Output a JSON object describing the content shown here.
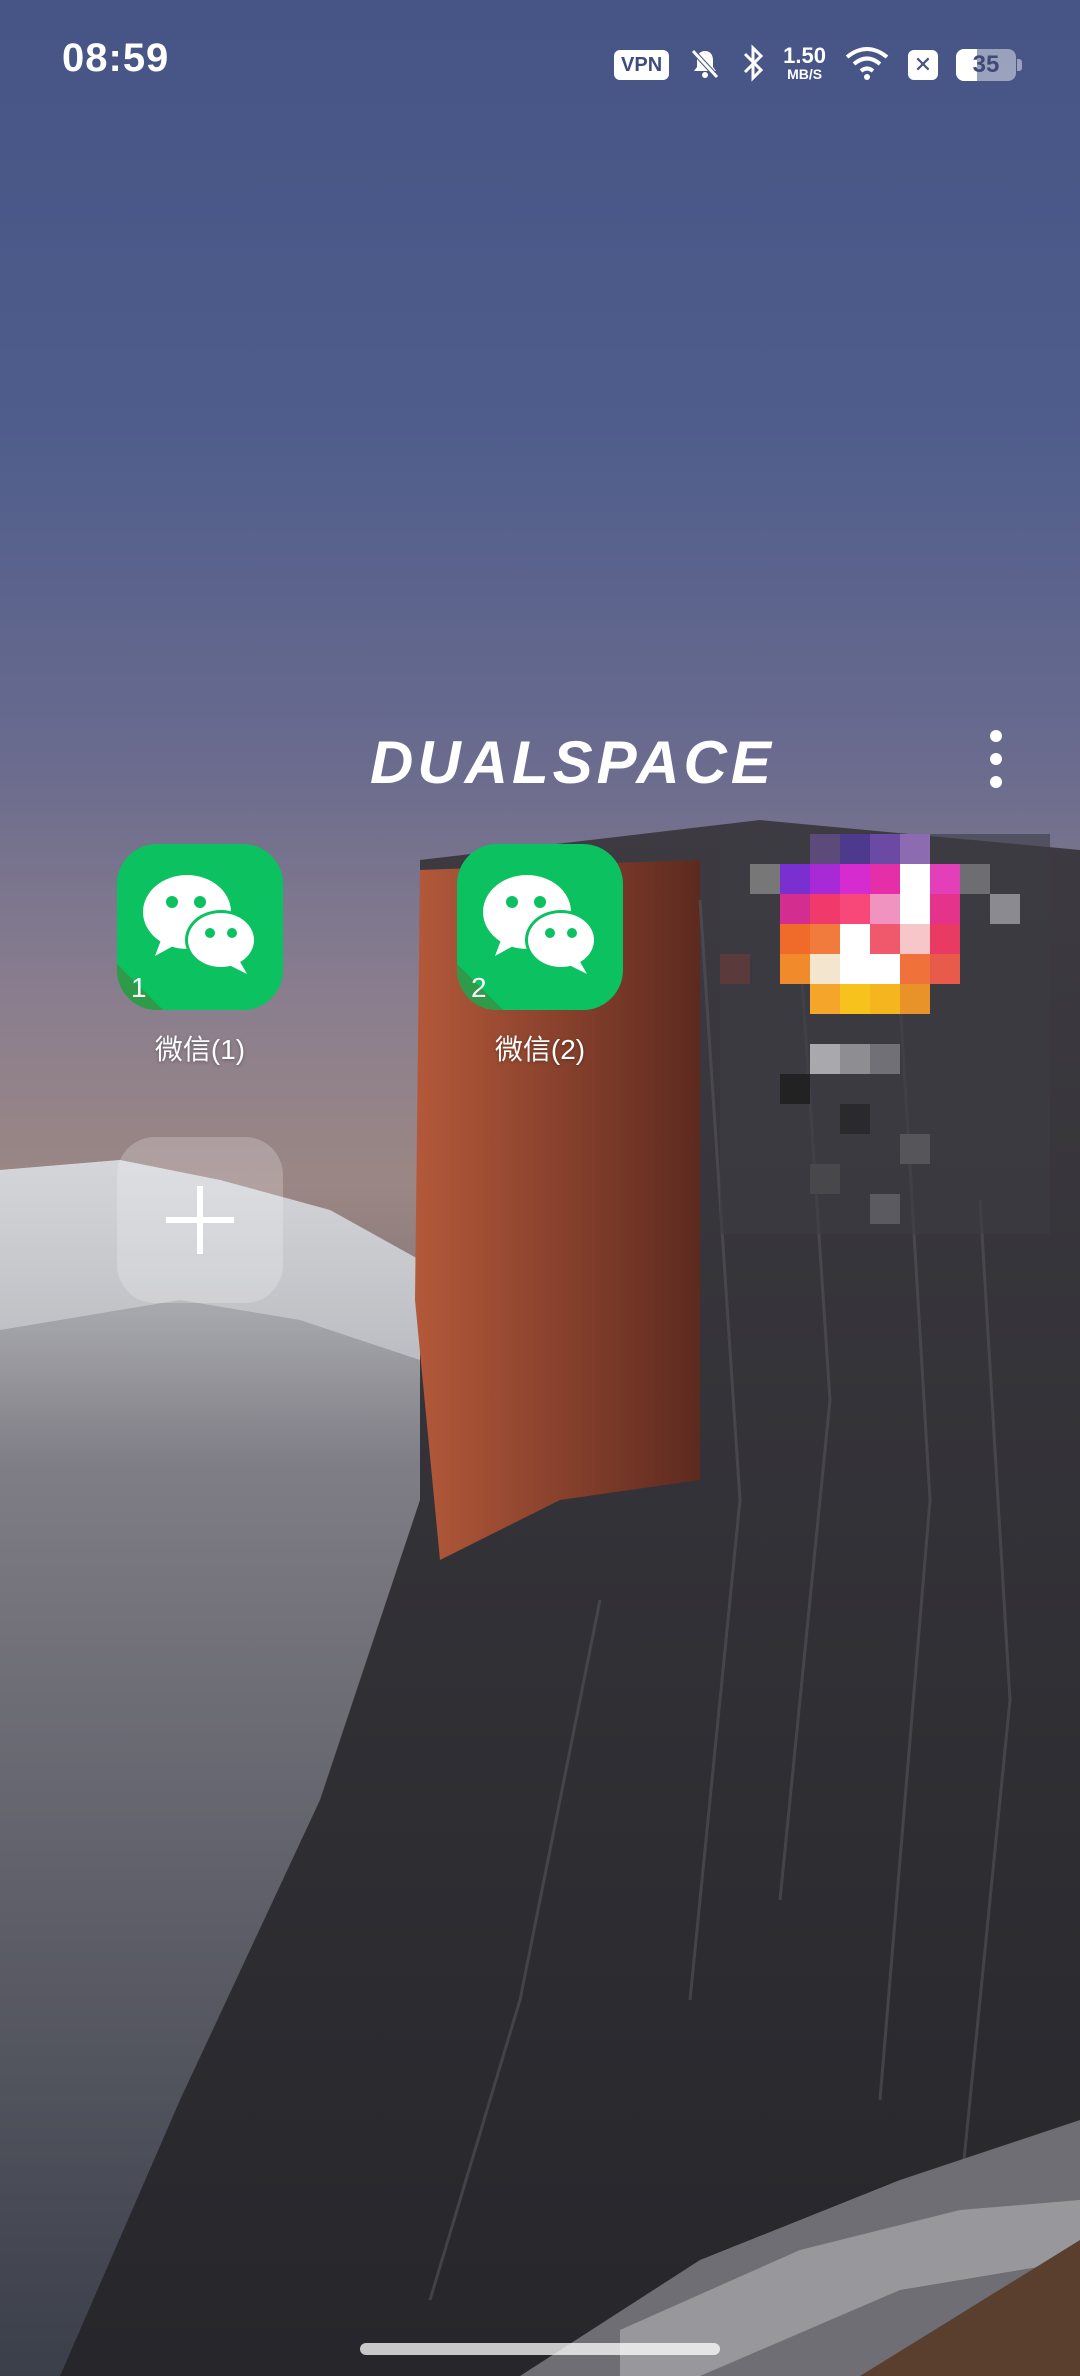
{
  "status_bar": {
    "time": "08:59",
    "vpn_label": "VPN",
    "net_speed_value": "1.50",
    "net_speed_unit": "MB/S",
    "battery_level": "35",
    "icons": [
      "mute-bell-icon",
      "bluetooth-icon",
      "wifi-icon",
      "close-badge-icon",
      "battery-icon"
    ]
  },
  "header": {
    "logo_text": "DUALSPACE",
    "menu_icon": "more-vertical-icon"
  },
  "apps": [
    {
      "label": "微信(1)",
      "badge": "1",
      "icon": "wechat-icon"
    },
    {
      "label": "微信(2)",
      "badge": "2",
      "icon": "wechat-icon"
    }
  ],
  "add_app": {
    "icon": "plus-icon"
  },
  "colors": {
    "wechat_green": "#0bc160",
    "accent_white": "#ffffff"
  }
}
